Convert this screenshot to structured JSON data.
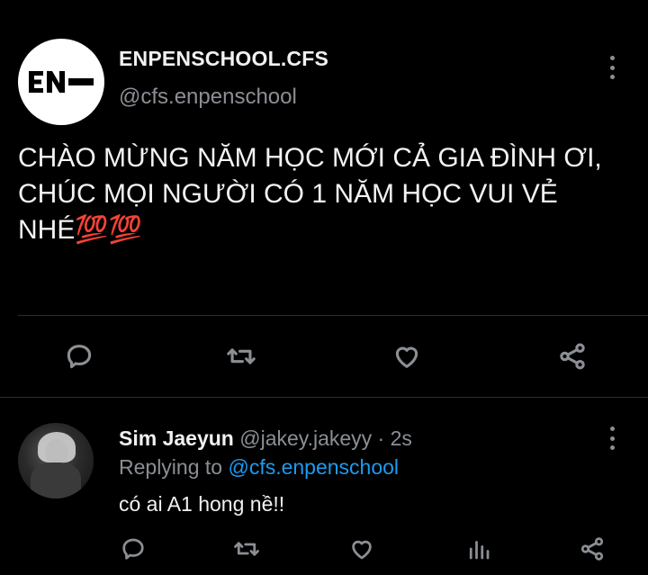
{
  "main_tweet": {
    "display_name": "ENPENSCHOOL.CFS",
    "handle": "@cfs.enpenschool",
    "avatar_logo_text": "EN-",
    "text": "CHÀO MỪNG NĂM HỌC MỚI CẢ GIA ĐÌNH ƠI,\nCHÚC MỌI NGƯỜI CÓ 1 NĂM HỌC VUI VẺ\nNHÉ💯💯",
    "actions": [
      "reply-icon",
      "retweet-icon",
      "like-icon",
      "share-icon"
    ]
  },
  "reply": {
    "display_name": "Sim Jaeyun",
    "handle": "@jakey.jakeyy",
    "separator": "·",
    "time": "2s",
    "replying_prefix": "Replying to",
    "replying_to": "@cfs.enpenschool",
    "text": "có ai A1 hong nề!!",
    "actions": [
      "reply-icon",
      "retweet-icon",
      "like-icon",
      "analytics-icon",
      "share-icon"
    ]
  },
  "colors": {
    "background": "#000000",
    "text": "#e7e9ea",
    "muted": "#8b8f94",
    "link": "#1d9bf0"
  }
}
